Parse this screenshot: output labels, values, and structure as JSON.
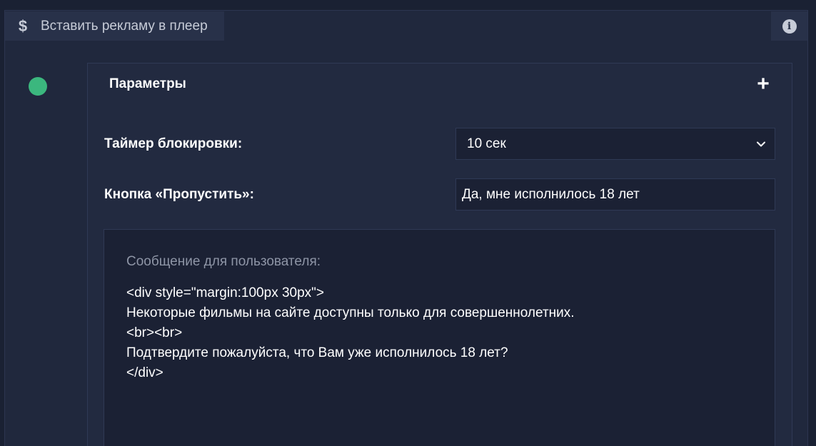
{
  "tab": {
    "icon": "dollar-icon",
    "icon_glyph": "$",
    "label": "Вставить рекламу в плеер"
  },
  "info_button": {
    "icon": "info-icon",
    "glyph": "i"
  },
  "status": {
    "color": "#3bb77e"
  },
  "panel": {
    "title": "Параметры",
    "toggle_glyph": "+"
  },
  "timer": {
    "label": "Таймер блокировки:",
    "selected": "10 сек"
  },
  "skip_button": {
    "label": "Кнопка «Пропустить»:",
    "value": "Да, мне исполнилось 18 лет"
  },
  "message": {
    "label": "Сообщение для пользователя:",
    "value": "<div style=\"margin:100px 30px\">\nНекоторые фильмы на сайте доступны только для совершеннолетних.\n<br><br>\nПодтвердите пожалуйста, что Вам уже исполнилось 18 лет?\n</div>"
  },
  "colors": {
    "background": "#1a2133",
    "panel": "#222a40",
    "field": "#1b2134",
    "accent_green": "#3bb77e"
  }
}
